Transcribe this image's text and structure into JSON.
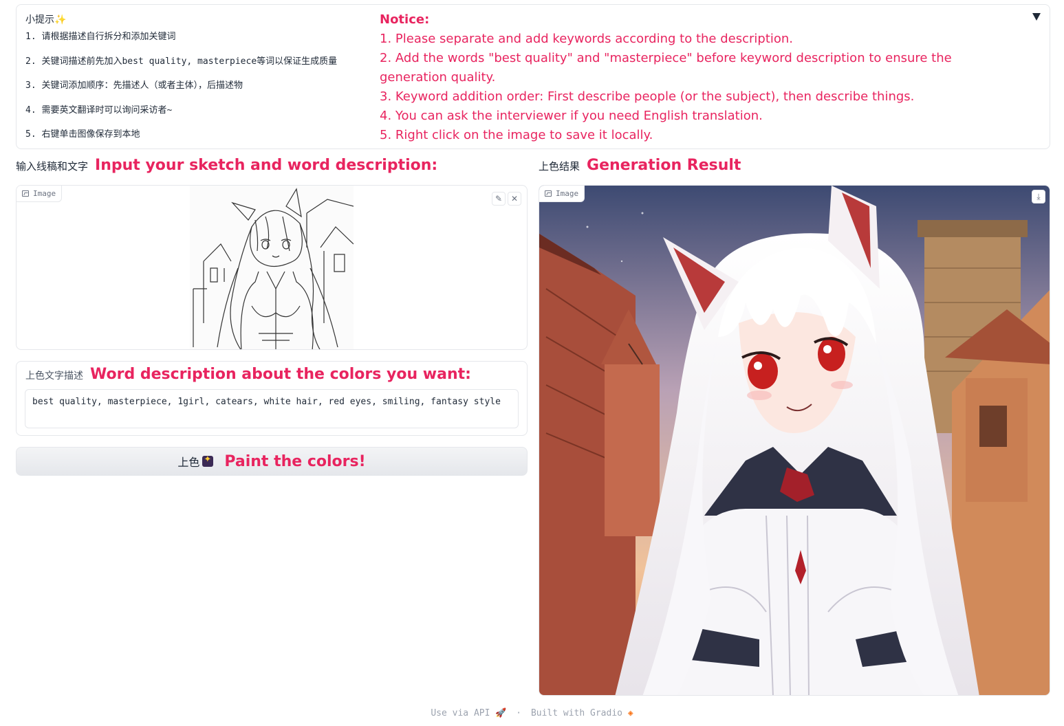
{
  "tips": {
    "title": "小提示✨",
    "items": [
      "1. 请根据描述自行拆分和添加关键词",
      "2. 关键词描述前先加入best quality, masterpiece等词以保证生成质量",
      "3. 关键词添加顺序：先描述人（或者主体），后描述物",
      "4. 需要英文翻译时可以询问采访者~",
      "5. 右键单击图像保存到本地"
    ]
  },
  "notice": {
    "title": "Notice:",
    "items": [
      "1. Please separate and add keywords according to the description.",
      "2. Add the words \"best quality\" and \"masterpiece\" before keyword description to ensure the generation quality.",
      "3. Keyword addition order: First describe people (or the subject), then describe things.",
      "4. You can ask the interviewer if you need English translation.",
      "5. Right click on the image to save it locally."
    ]
  },
  "input_section": {
    "label_cn": "输入线稿和文字",
    "label_en": "Input your sketch and word description:",
    "image_tag": "Image"
  },
  "output_section": {
    "label_cn": "上色结果",
    "label_en": "Generation Result",
    "image_tag": "Image"
  },
  "description": {
    "label_cn": "上色文字描述",
    "label_en": "Word description about the colors you want:",
    "value": "best quality, masterpiece, 1girl, catears, white hair, red eyes, smiling, fantasy style"
  },
  "paint_button": {
    "label_cn": "上色",
    "label_en": "Paint the colors!"
  },
  "footer": {
    "api": "Use via API",
    "separator": "·",
    "built": "Built with Gradio"
  },
  "colors": {
    "accent_pink": "#e8245f",
    "border": "#e5e7eb"
  }
}
